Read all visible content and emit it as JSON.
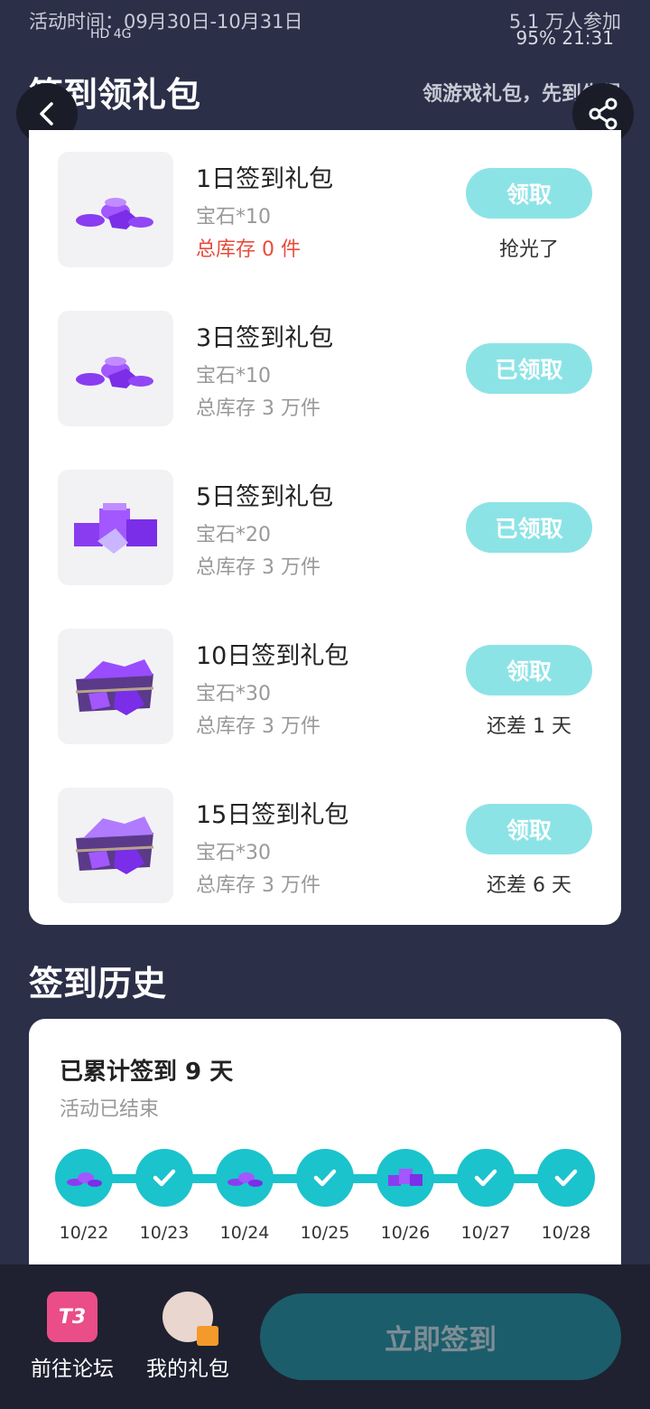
{
  "status": {
    "activity_time": "活动时间：09月30日-10月31日",
    "participants": "5.1 万人参加",
    "signal": "HD 4G",
    "battery_time": "95%  21:31"
  },
  "header": {
    "title": "签到领礼包",
    "subtitle": "领游戏礼包，先到先得"
  },
  "gifts": [
    {
      "name": "1日签到礼包",
      "detail": "宝石*10",
      "stock": "总库存 0 件",
      "button": "领取",
      "note": "抢光了"
    },
    {
      "name": "3日签到礼包",
      "detail": "宝石*10",
      "stock": "总库存 3 万件",
      "button": "已领取",
      "note": ""
    },
    {
      "name": "5日签到礼包",
      "detail": "宝石*20",
      "stock": "总库存 3 万件",
      "button": "已领取",
      "note": ""
    },
    {
      "name": "10日签到礼包",
      "detail": "宝石*30",
      "stock": "总库存 3 万件",
      "button": "领取",
      "note": "还差 1 天"
    },
    {
      "name": "15日签到礼包",
      "detail": "宝石*30",
      "stock": "总库存 3 万件",
      "button": "领取",
      "note": "还差 6 天"
    }
  ],
  "history": {
    "section_title": "签到历史",
    "total": "已累计签到 9 天",
    "status": "活动已结束",
    "days": [
      {
        "date": "10/22",
        "icon": "gem-icon"
      },
      {
        "date": "10/23",
        "icon": "check-icon"
      },
      {
        "date": "10/24",
        "icon": "gem-icon"
      },
      {
        "date": "10/25",
        "icon": "check-icon"
      },
      {
        "date": "10/26",
        "icon": "gem-pile-icon"
      },
      {
        "date": "10/27",
        "icon": "check-icon"
      },
      {
        "date": "10/28",
        "icon": "check-icon"
      }
    ]
  },
  "bottom": {
    "forum_icon": "T3",
    "forum_label": "前往论坛",
    "gift_label": "我的礼包",
    "signin_label": "立即签到"
  },
  "colors": {
    "background": "#2b2f48",
    "accent": "#1bc3cc",
    "button_light": "#8ce3e6",
    "signin_button": "#1b5d6b",
    "warning_red": "#e74c3c"
  }
}
